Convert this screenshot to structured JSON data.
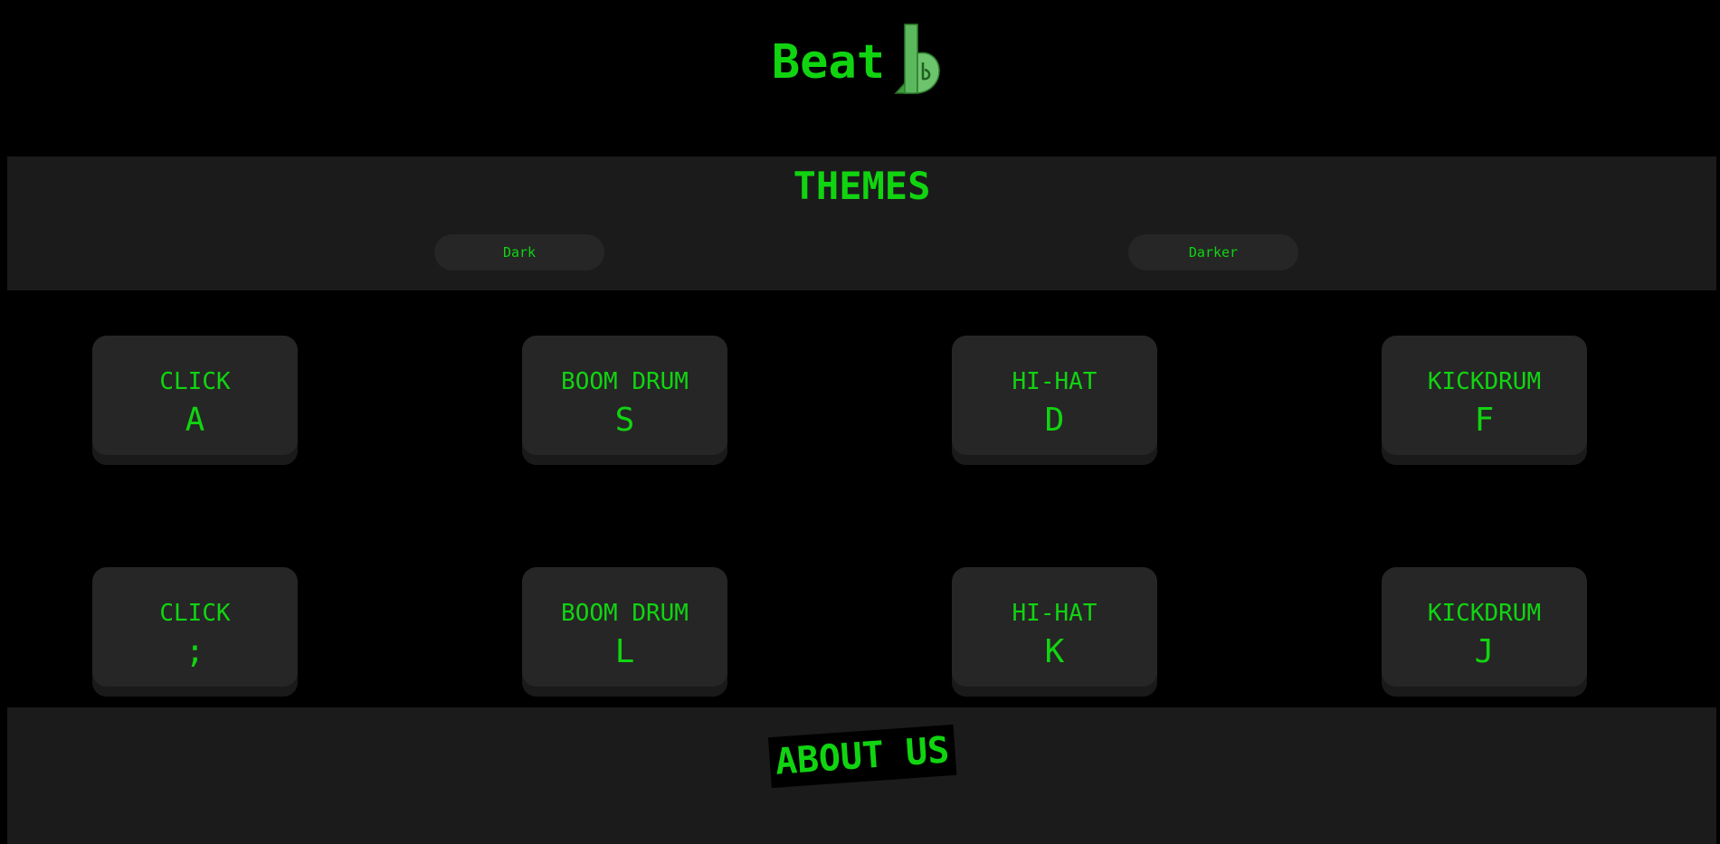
{
  "header": {
    "logo_text": "Beat",
    "logo_icon": "b-note-icon"
  },
  "themes": {
    "title": "THEMES",
    "buttons": [
      {
        "label": "Dark"
      },
      {
        "label": "Darker"
      }
    ]
  },
  "pads": [
    {
      "name": "CLICK",
      "key": "A"
    },
    {
      "name": "BOOM DRUM",
      "key": "S"
    },
    {
      "name": "HI-HAT",
      "key": "D"
    },
    {
      "name": "KICKDRUM",
      "key": "F"
    },
    {
      "name": "CLICK",
      "key": ";"
    },
    {
      "name": "BOOM DRUM",
      "key": "L"
    },
    {
      "name": "HI-HAT",
      "key": "K"
    },
    {
      "name": "KICKDRUM",
      "key": "J"
    }
  ],
  "about": {
    "title": "ABOUT US"
  },
  "colors": {
    "accent": "#11d411",
    "background": "#000000",
    "panel": "#1b1b1b",
    "pad": "#262626"
  }
}
